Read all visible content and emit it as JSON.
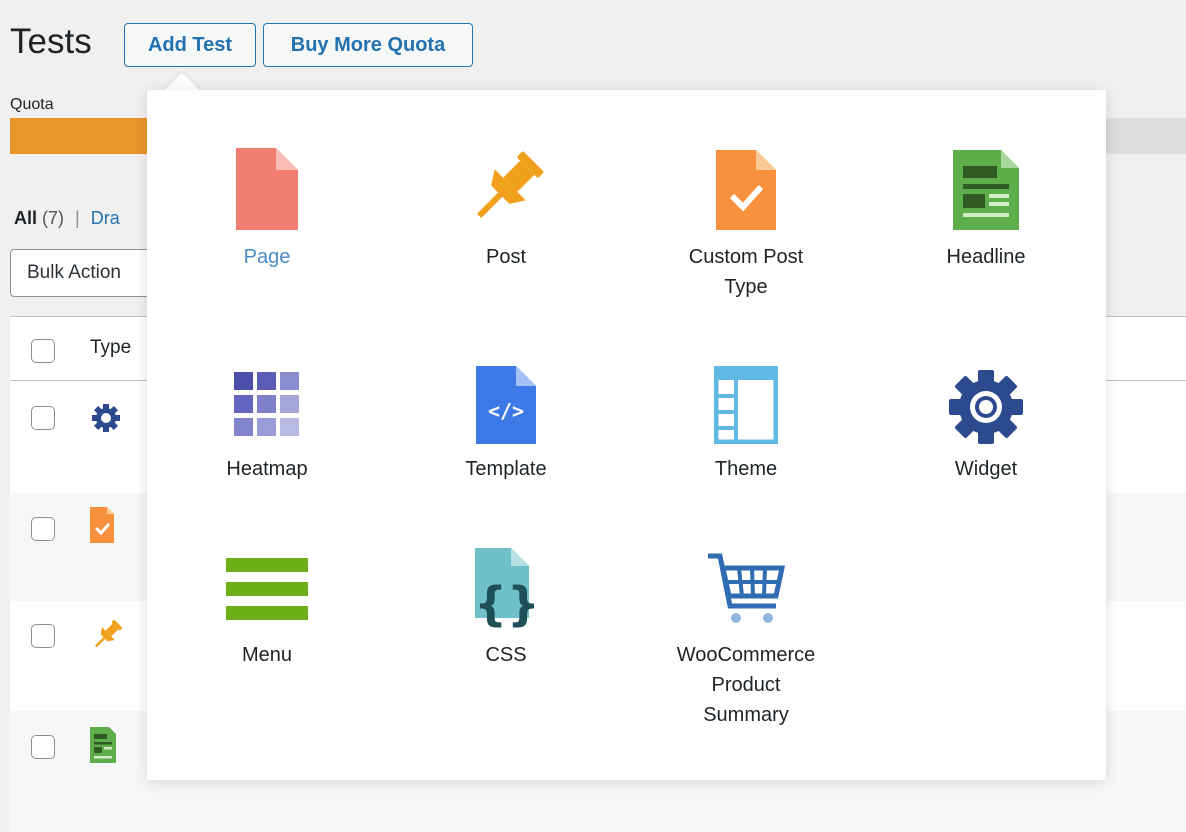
{
  "header": {
    "title": "Tests",
    "add_test_label": "Add Test",
    "buy_quota_label": "Buy More Quota"
  },
  "quota": {
    "label": "Quota",
    "used_fraction": 0.12,
    "fill_color": "#e8962a"
  },
  "filters": {
    "all_label": "All",
    "all_count": "(7)",
    "separator": "|",
    "drafts_label": "Dra"
  },
  "bulk_actions": {
    "selected": "Bulk Action"
  },
  "table": {
    "column_type": "Type",
    "rows": [
      {
        "type_icon": "widget-gear-icon"
      },
      {
        "type_icon": "custom-post-type-icon"
      },
      {
        "type_icon": "post-pin-icon"
      },
      {
        "type_icon": "headline-icon"
      }
    ]
  },
  "popup": {
    "items": [
      {
        "label": "Page",
        "icon": "page-icon",
        "active": true
      },
      {
        "label": "Post",
        "icon": "pushpin-icon"
      },
      {
        "label": "Custom Post Type",
        "icon": "custom-post-type-icon"
      },
      {
        "label": "Headline",
        "icon": "headline-icon"
      },
      {
        "label": "Heatmap",
        "icon": "heatmap-icon"
      },
      {
        "label": "Template",
        "icon": "template-icon"
      },
      {
        "label": "Theme",
        "icon": "theme-icon"
      },
      {
        "label": "Widget",
        "icon": "gear-icon"
      },
      {
        "label": "Menu",
        "icon": "menu-icon"
      },
      {
        "label": "CSS",
        "icon": "css-icon"
      },
      {
        "label": "WooCommerce Product Summary",
        "icon": "cart-icon"
      }
    ]
  },
  "colors": {
    "link": "#2271b1",
    "active_tile": "#4a8bc4",
    "page_icon": "#f07f72",
    "pin": "#f0a11b",
    "custom_post": "#f7913e",
    "headline": "#5fae4c",
    "heatmap": "#5b5cb5",
    "template": "#3d7ae8",
    "theme": "#5fb9e2",
    "widget": "#2e4a8e",
    "menu": "#6eb017",
    "css": "#6fc0c8",
    "cart": "#2f6cb2"
  }
}
